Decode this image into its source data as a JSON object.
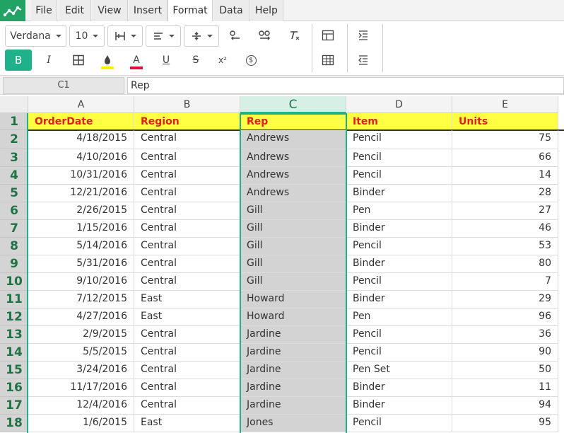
{
  "menu": {
    "tabs": [
      {
        "label": "File"
      },
      {
        "label": "Edit"
      },
      {
        "label": "View"
      },
      {
        "label": "Insert"
      },
      {
        "label": "Format"
      },
      {
        "label": "Data"
      },
      {
        "label": "Help"
      }
    ],
    "active_tab": "Format"
  },
  "ribbon": {
    "font_family": "Verdana",
    "font_size": "10",
    "bold_label": "B",
    "italic_label": "I",
    "font_color_label": "A",
    "underline_label": "U",
    "strike_label": "S",
    "superscript_label": "x²",
    "currency_label": "$",
    "fill_color": "#ffef00",
    "font_color": "#e0103c"
  },
  "formula_bar": {
    "name_box": "C1",
    "value": "Rep"
  },
  "sheet": {
    "accent_color": "#1fb28a",
    "selected_column": "C",
    "columns": [
      "A",
      "B",
      "C",
      "D",
      "E"
    ],
    "row_numbers": [
      "1",
      "2",
      "3",
      "4",
      "5",
      "6",
      "7",
      "8",
      "9",
      "10",
      "11",
      "12",
      "13",
      "14",
      "15",
      "16",
      "17",
      "18"
    ],
    "header_row": [
      "OrderDate",
      "Region",
      "Rep",
      "Item",
      "Units"
    ],
    "rows": [
      [
        "4/18/2015",
        "Central",
        "Andrews",
        "Pencil",
        "75"
      ],
      [
        "4/10/2016",
        "Central",
        "Andrews",
        "Pencil",
        "66"
      ],
      [
        "10/31/2016",
        "Central",
        "Andrews",
        "Pencil",
        "14"
      ],
      [
        "12/21/2016",
        "Central",
        "Andrews",
        "Binder",
        "28"
      ],
      [
        "2/26/2015",
        "Central",
        "Gill",
        "Pen",
        "27"
      ],
      [
        "1/15/2016",
        "Central",
        "Gill",
        "Binder",
        "46"
      ],
      [
        "5/14/2016",
        "Central",
        "Gill",
        "Pencil",
        "53"
      ],
      [
        "5/31/2016",
        "Central",
        "Gill",
        "Binder",
        "80"
      ],
      [
        "9/10/2016",
        "Central",
        "Gill",
        "Pencil",
        "7"
      ],
      [
        "7/12/2015",
        "East",
        "Howard",
        "Binder",
        "29"
      ],
      [
        "4/27/2016",
        "East",
        "Howard",
        "Pen",
        "96"
      ],
      [
        "2/9/2015",
        "Central",
        "Jardine",
        "Pencil",
        "36"
      ],
      [
        "5/5/2015",
        "Central",
        "Jardine",
        "Pencil",
        "90"
      ],
      [
        "3/24/2016",
        "Central",
        "Jardine",
        "Pen Set",
        "50"
      ],
      [
        "11/17/2016",
        "Central",
        "Jardine",
        "Binder",
        "11"
      ],
      [
        "12/4/2016",
        "Central",
        "Jardine",
        "Binder",
        "94"
      ],
      [
        "1/6/2015",
        "East",
        "Jones",
        "Pencil",
        "95"
      ]
    ]
  }
}
